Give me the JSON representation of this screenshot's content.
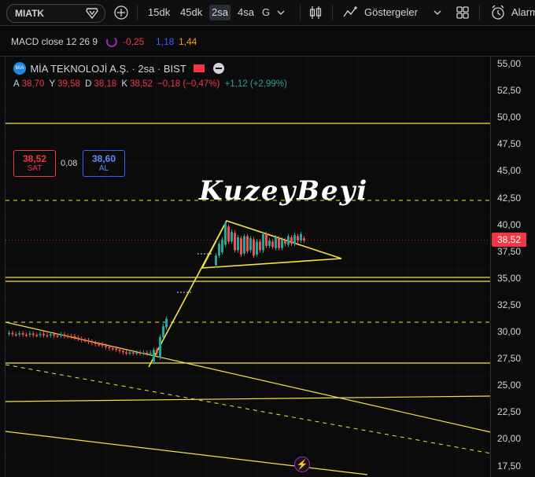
{
  "toolbar": {
    "symbol": "MIATK",
    "intervals": [
      "15dk",
      "45dk",
      "2sa",
      "4sa",
      "G"
    ],
    "active_interval": "2sa",
    "indicators_label": "Göstergeler",
    "alarm_label": "Alarm"
  },
  "macd": {
    "label": "MACD close 12 26 9",
    "value1": "-0,25",
    "value2": "1,18",
    "value3": "1,44"
  },
  "legend": {
    "logo_text": "MİA",
    "title": "MİA TEKNOLOJİ A.Ş. · 2sa · BIST",
    "o_label": "A",
    "o_value": "38,70",
    "h_label": "Y",
    "h_value": "39,58",
    "l_label": "D",
    "l_value": "38,18",
    "c_label": "K",
    "c_value": "38,52",
    "change": "−0,18 (−0,47%)",
    "volume_change": "+1,12 (+2,99%)",
    "sell_price": "38,52",
    "sell_label": "SAT",
    "spread": "0,08",
    "buy_price": "38,60",
    "buy_label": "AL"
  },
  "watermark": "KuzeyBeyi",
  "price_axis": {
    "ticks": [
      "55,00",
      "52,50",
      "50,00",
      "47,50",
      "45,00",
      "42,50",
      "40,00",
      "37,50",
      "35,00",
      "32,50",
      "30,00",
      "27,50",
      "25,00",
      "22,50",
      "20,00",
      "17,50"
    ],
    "current_price": "38,52",
    "current_color": "#f23645"
  },
  "colors": {
    "up": "#26a69a",
    "down": "#ef5350",
    "drawing": "#f5e342",
    "macd_red": "#f23645",
    "macd_blue": "#2962ff",
    "macd_orange": "#ff9800"
  }
}
